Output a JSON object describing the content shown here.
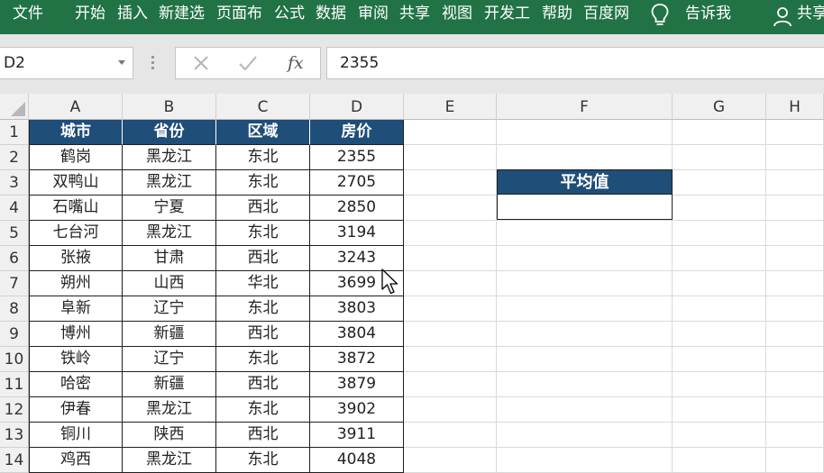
{
  "ribbon": {
    "tabs": [
      "文件",
      "开始",
      "插入",
      "新建选",
      "页面布",
      "公式",
      "数据",
      "审阅",
      "共享",
      "视图",
      "开发工",
      "帮助",
      "百度网"
    ],
    "tell_me": "告诉我",
    "share": "共享",
    "bg_color": "#217346"
  },
  "formula_bar": {
    "name_box": "D2",
    "fx_label": "fx",
    "formula": "2355",
    "icons": [
      "cancel-x-icon",
      "enter-check-icon",
      "insert-function-icon"
    ]
  },
  "columns": [
    "A",
    "B",
    "C",
    "D",
    "E",
    "F",
    "G",
    "H"
  ],
  "rows": [
    "1",
    "2",
    "3",
    "4",
    "5",
    "6",
    "7",
    "8",
    "9",
    "10",
    "11",
    "12",
    "13",
    "14"
  ],
  "table": {
    "headers": [
      "城市",
      "省份",
      "区域",
      "房价"
    ],
    "rows": [
      [
        "鹤岗",
        "黑龙江",
        "东北",
        "2355"
      ],
      [
        "双鸭山",
        "黑龙江",
        "东北",
        "2705"
      ],
      [
        "石嘴山",
        "宁夏",
        "西北",
        "2850"
      ],
      [
        "七台河",
        "黑龙江",
        "东北",
        "3194"
      ],
      [
        "张掖",
        "甘肃",
        "西北",
        "3243"
      ],
      [
        "朔州",
        "山西",
        "华北",
        "3699"
      ],
      [
        "阜新",
        "辽宁",
        "东北",
        "3803"
      ],
      [
        "博州",
        "新疆",
        "西北",
        "3804"
      ],
      [
        "铁岭",
        "辽宁",
        "东北",
        "3872"
      ],
      [
        "哈密",
        "新疆",
        "西北",
        "3879"
      ],
      [
        "伊春",
        "黑龙江",
        "东北",
        "3902"
      ],
      [
        "铜川",
        "陕西",
        "西北",
        "3911"
      ],
      [
        "鸡西",
        "黑龙江",
        "东北",
        "4048"
      ]
    ],
    "header_color": "#1f4e79"
  },
  "average": {
    "label": "平均值",
    "value": ""
  }
}
